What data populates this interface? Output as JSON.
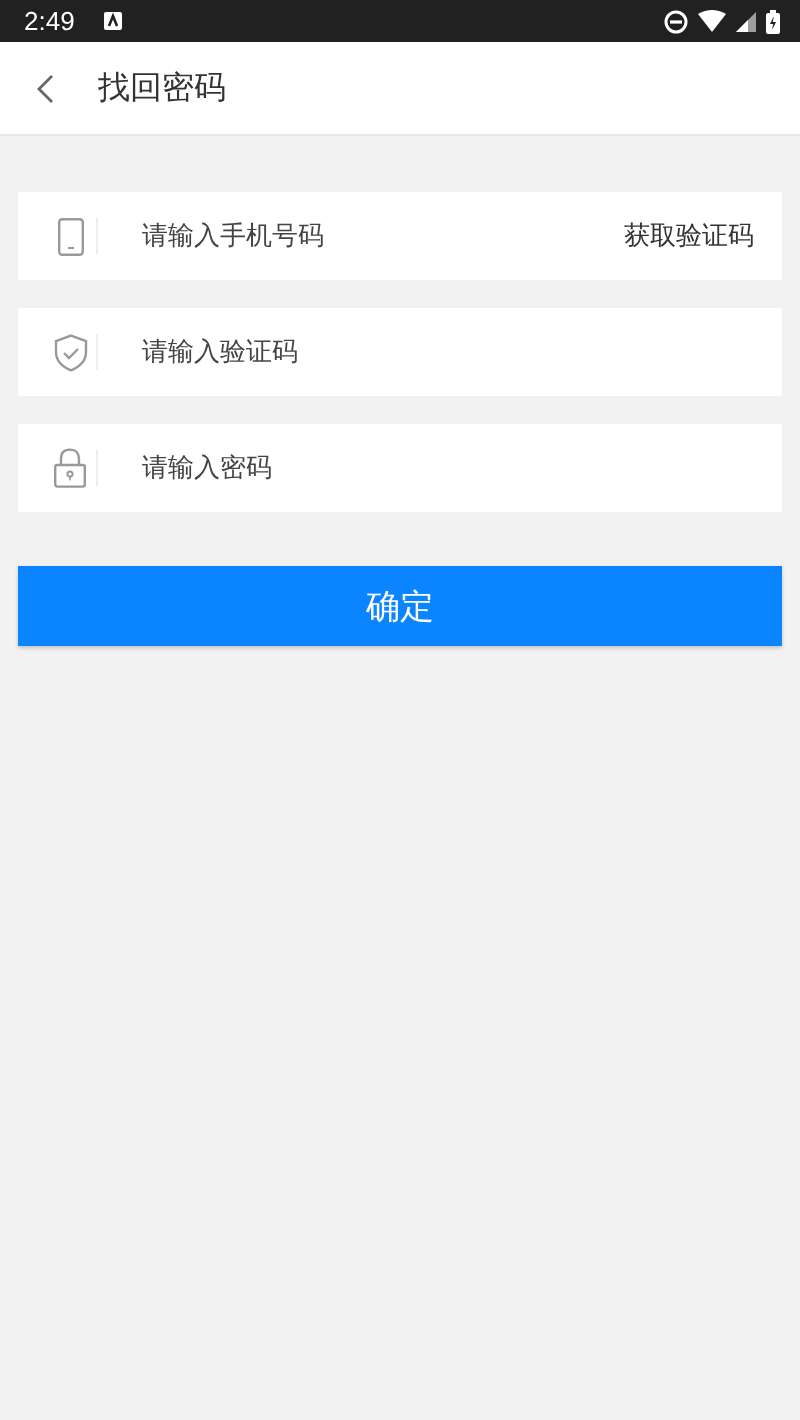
{
  "status_bar": {
    "time": "2:49"
  },
  "header": {
    "title": "找回密码"
  },
  "fields": [
    {
      "kind": "phone",
      "placeholder": "请输入手机号码",
      "action": "获取验证码"
    },
    {
      "kind": "shield",
      "placeholder": "请输入验证码"
    },
    {
      "kind": "lock",
      "placeholder": "请输入密码"
    }
  ],
  "submit": {
    "label": "确定"
  }
}
